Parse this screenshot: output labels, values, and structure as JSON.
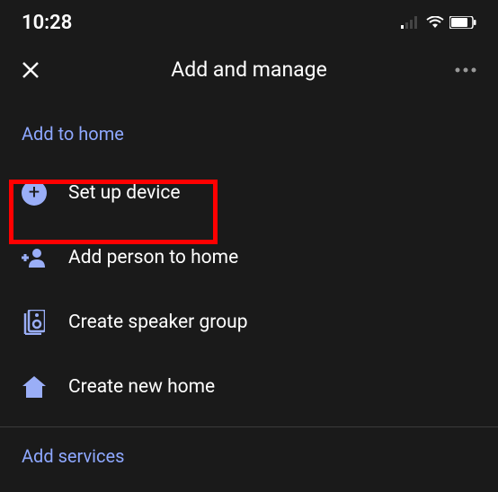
{
  "status": {
    "time": "10:28"
  },
  "header": {
    "title": "Add and manage"
  },
  "sections": {
    "add_to_home": {
      "title": "Add to home",
      "items": [
        {
          "label": "Set up device"
        },
        {
          "label": "Add person to home"
        },
        {
          "label": "Create speaker group"
        },
        {
          "label": "Create new home"
        }
      ]
    },
    "add_services": {
      "title": "Add services"
    }
  }
}
